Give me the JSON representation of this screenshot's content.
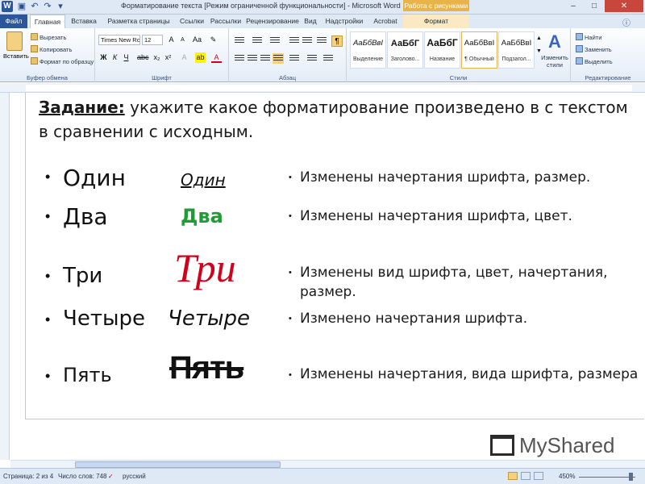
{
  "window": {
    "title": "Форматирование текста [Режим ограниченной функциональности]  -  Microsoft Word",
    "picture_tools": "Работа с рисунками",
    "logo": "W",
    "min": "–",
    "max": "□",
    "close": "✕"
  },
  "tabs": [
    {
      "label": "Файл"
    },
    {
      "label": "Главная"
    },
    {
      "label": "Вставка"
    },
    {
      "label": "Разметка страницы"
    },
    {
      "label": "Ссылки"
    },
    {
      "label": "Рассылки"
    },
    {
      "label": "Рецензирование"
    },
    {
      "label": "Вид"
    },
    {
      "label": "Надстройки"
    },
    {
      "label": "Acrobat"
    },
    {
      "label": "Формат"
    }
  ],
  "ribbon": {
    "clipboard": {
      "paste": "Вставить",
      "cut": "Вырезать",
      "copy": "Копировать",
      "format_painter": "Формат по образцу",
      "label": "Буфер обмена"
    },
    "font": {
      "font_name": "Times New Rc",
      "font_size": "12",
      "label": "Шрифт"
    },
    "paragraph": {
      "label": "Абзац",
      "pilcrow": "¶"
    },
    "styles": {
      "label": "Стили",
      "items": [
        {
          "sample": "АаБбВвІ",
          "name": "Выделение"
        },
        {
          "sample": "АаБбГ",
          "name": "Заголово..."
        },
        {
          "sample": "АаБбГ",
          "name": "Название"
        },
        {
          "sample": "АаБбВвІ",
          "name": "¶ Обычный"
        },
        {
          "sample": "АаБбВвІ",
          "name": "Подзагол..."
        }
      ],
      "change": "Изменить стили"
    },
    "editing": {
      "find": "Найти",
      "replace": "Заменить",
      "select": "Выделить",
      "label": "Редактирование"
    }
  },
  "document": {
    "task_label": "Задание:",
    "task_text": " укажите какое форматирование произведено в с текстом в сравнении с исходным.",
    "rows": [
      {
        "original": "Один",
        "formatted": "Один",
        "description": "Изменены начертания шрифта, размер."
      },
      {
        "original": "Два",
        "formatted": "Два",
        "description": "Изменены начертания шрифта, цвет."
      },
      {
        "original": "Три",
        "formatted": "Три",
        "description": "Изменены вид шрифта, цвет, начертания, размер."
      },
      {
        "original": "Четыре",
        "formatted": "Четыре",
        "description": "Изменено начертания шрифта."
      },
      {
        "original": "Пять",
        "formatted": "Пять",
        "description": "Изменены начертания, вида шрифта, размера"
      }
    ],
    "colors": {
      "green": "#1e9d34",
      "red": "#d0021b"
    }
  },
  "statusbar": {
    "page": "Страница: 2 из 4",
    "words": "Число слов: 748",
    "language": "русский",
    "zoom": "450%"
  },
  "watermark": {
    "text": "MyShared"
  }
}
